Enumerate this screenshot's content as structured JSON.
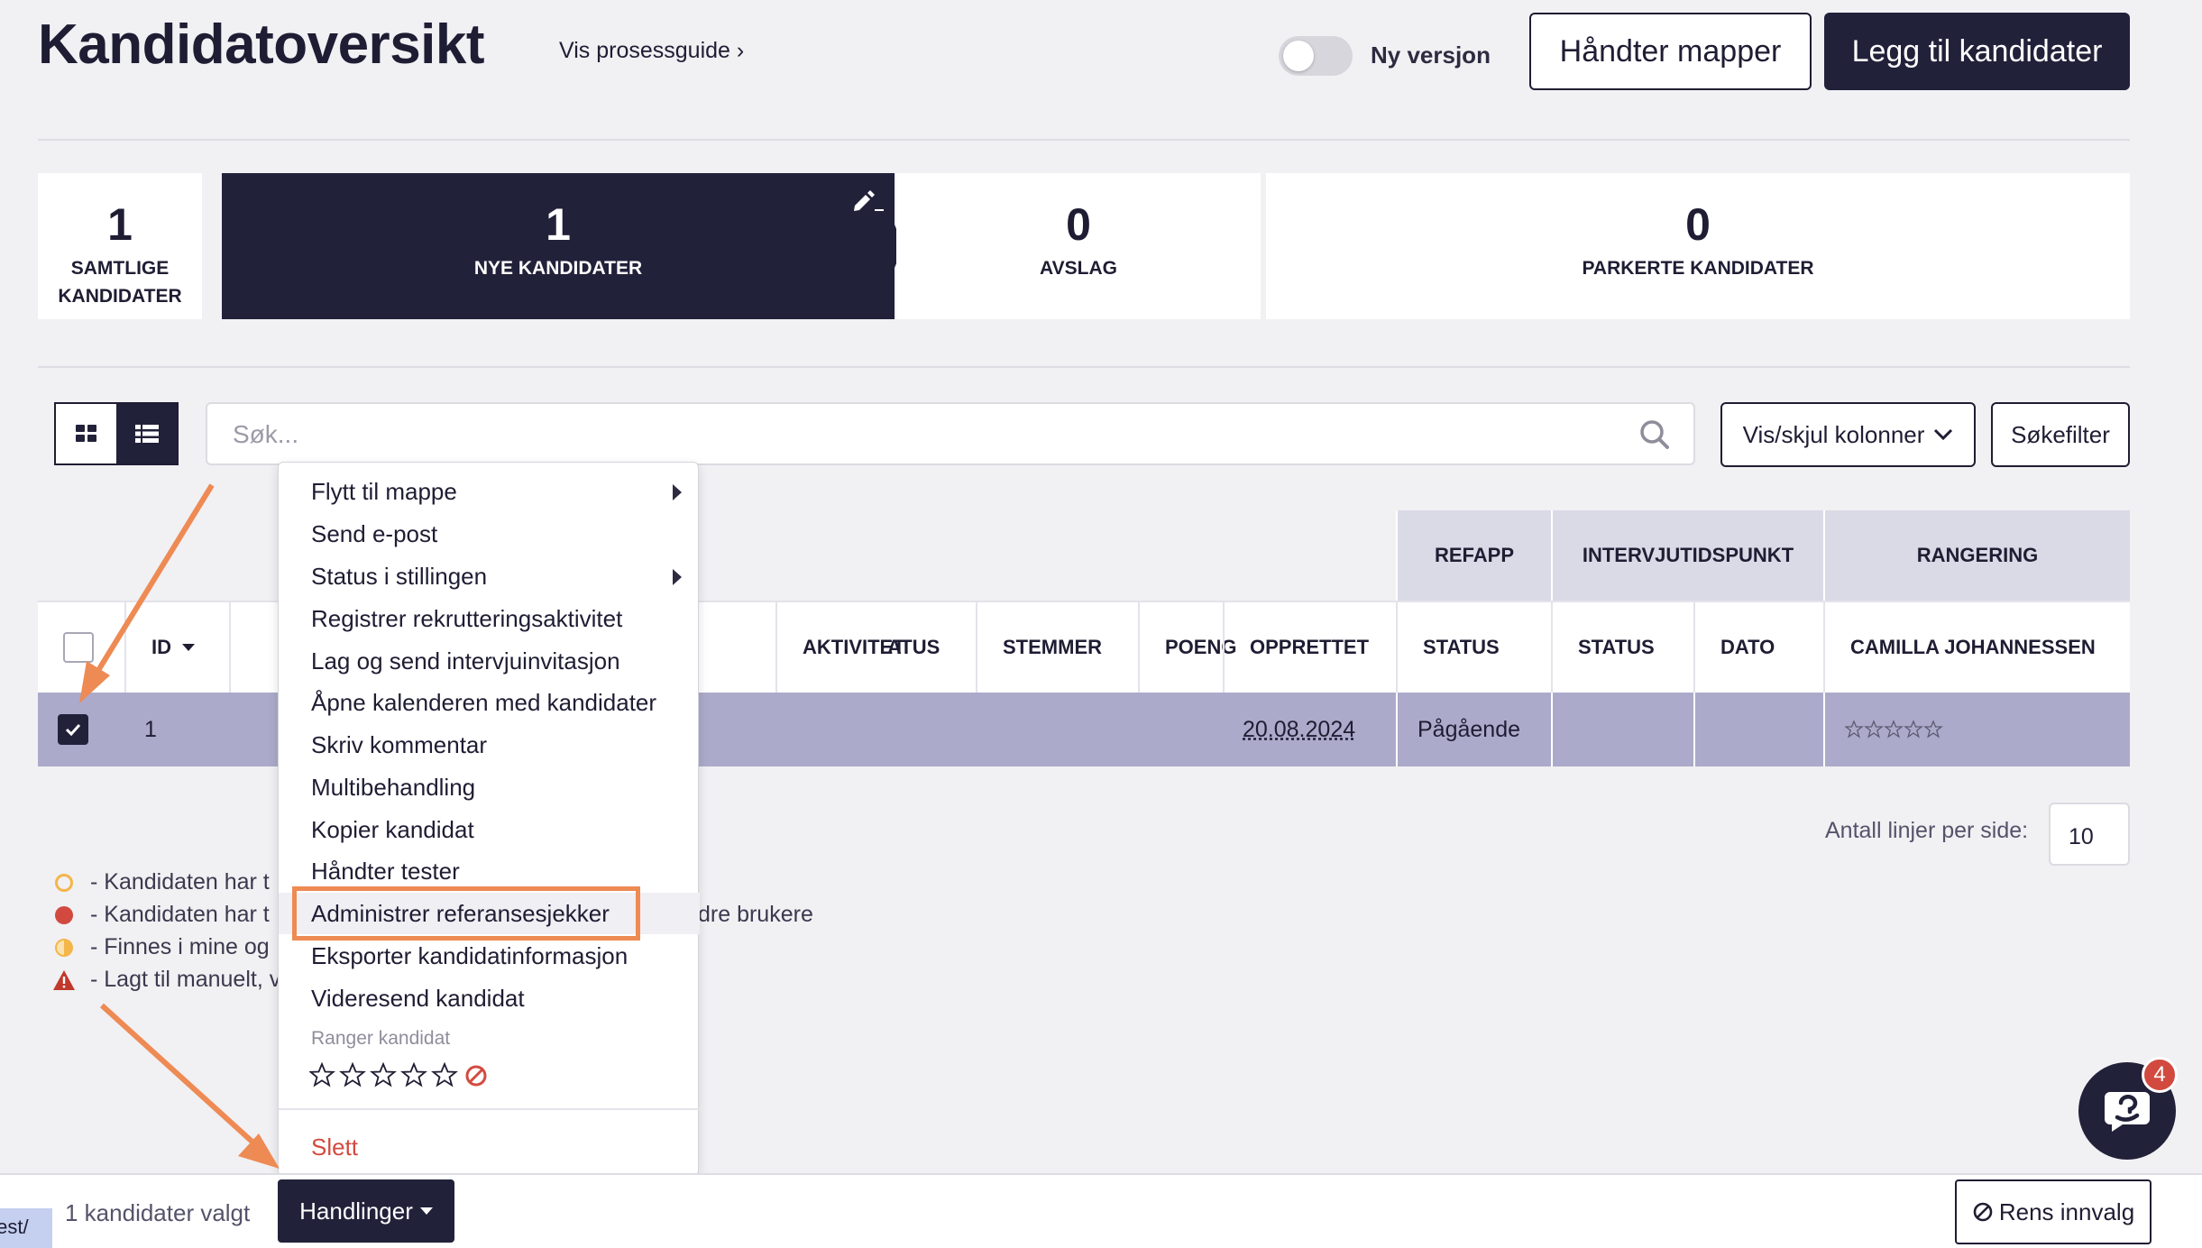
{
  "header": {
    "title": "Kandidatoversikt",
    "guide_link": "Vis prosessguide ›",
    "toggle_label": "Ny versjon",
    "manage_folders": "Håndter mapper",
    "add_candidates": "Legg til kandidater"
  },
  "stats": [
    {
      "count": "1",
      "label_line1": "SAMTLIGE",
      "label_line2": "KANDIDATER"
    },
    {
      "count": "1",
      "label": "NYE KANDIDATER"
    },
    {
      "count": "0",
      "label": "AVSLAG"
    },
    {
      "count": "0",
      "label": "PARKERTE KANDIDATER"
    }
  ],
  "toolbar": {
    "search_placeholder": "Søk...",
    "columns_button": "Vis/skjul kolonner",
    "filter_button": "Søkefilter"
  },
  "table": {
    "groups": [
      "REFAPP",
      "INTERVJUTIDSPUNKT",
      "RANGERING"
    ],
    "headers": {
      "id": "ID",
      "status_partial": "ATUS",
      "activity": "AKTIVITET",
      "votes": "STEMMER",
      "points": "POENG",
      "created": "OPPRETTET",
      "refapp_status": "STATUS",
      "interview_status": "STATUS",
      "interview_date": "DATO",
      "ranking_user": "CAMILLA JOHANNESSEN"
    },
    "row": {
      "id": "1",
      "created": "20.08.2024",
      "refapp_status": "Pågående"
    }
  },
  "legend": [
    "- Kandidaten har t",
    "- Kandidaten har t",
    "- Finnes i mine og",
    "- Lagt til manuelt, v"
  ],
  "legend_tail": "dre brukere",
  "pagination": {
    "label": "Antall linjer per side:",
    "value": "10"
  },
  "menu": {
    "items": [
      "Flytt til mappe",
      "Send e-post",
      "Status i stillingen",
      "Registrer rekrutteringsaktivitet",
      "Lag og send intervjuinvitasjon",
      "Åpne kalenderen med kandidater",
      "Skriv kommentar",
      "Multibehandling",
      "Kopier kandidat",
      "Håndter tester",
      "Administrer referansesjekker",
      "Eksporter kandidatinformasjon",
      "Videresend kandidat"
    ],
    "rank_label": "Ranger kandidat",
    "delete": "Slett"
  },
  "bottom": {
    "url_fragment": "test/",
    "selected_count": "1 kandidater valgt",
    "actions": "Handlinger",
    "clear": "Rens innvalg"
  },
  "chat": {
    "badge": "4"
  },
  "colors": {
    "dark": "#22213a",
    "accent_arrow": "#ee8a53",
    "selected_row": "#abaaca",
    "danger": "#d24a3f"
  }
}
